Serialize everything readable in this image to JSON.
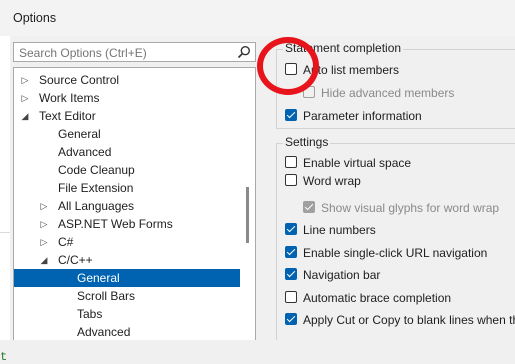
{
  "window": {
    "title": "Options"
  },
  "search": {
    "placeholder": "Search Options (Ctrl+E)",
    "icon": "search-icon"
  },
  "tree": {
    "items": [
      {
        "label": "Source Control",
        "expander": "collapsed"
      },
      {
        "label": "Work Items",
        "expander": "collapsed"
      },
      {
        "label": "Text Editor",
        "expander": "expanded"
      },
      {
        "label": "General",
        "expander": "none"
      },
      {
        "label": "Advanced",
        "expander": "none"
      },
      {
        "label": "Code Cleanup",
        "expander": "none"
      },
      {
        "label": "File Extension",
        "expander": "none"
      },
      {
        "label": "All Languages",
        "expander": "collapsed"
      },
      {
        "label": "ASP.NET Web Forms",
        "expander": "collapsed"
      },
      {
        "label": "C#",
        "expander": "collapsed"
      },
      {
        "label": "C/C++",
        "expander": "expanded"
      },
      {
        "label": "General",
        "expander": "none",
        "selected": true
      },
      {
        "label": "Scroll Bars",
        "expander": "none"
      },
      {
        "label": "Tabs",
        "expander": "none"
      },
      {
        "label": "Advanced",
        "expander": "none"
      }
    ]
  },
  "statement_completion": {
    "legend": "Statement completion",
    "options": [
      {
        "label": "Auto list members",
        "checked": false,
        "enabled": true
      },
      {
        "label": "Hide advanced members",
        "checked": false,
        "enabled": false
      },
      {
        "label": "Parameter information",
        "checked": true,
        "enabled": true
      }
    ]
  },
  "settings": {
    "legend": "Settings",
    "options": [
      {
        "label": "Enable virtual space",
        "checked": false,
        "enabled": true
      },
      {
        "label": "Word wrap",
        "checked": false,
        "enabled": true
      },
      {
        "label": "Show visual glyphs for word wrap",
        "checked": true,
        "enabled": false
      },
      {
        "label": "Line numbers",
        "checked": true,
        "enabled": true
      },
      {
        "label": "Enable single-click URL navigation",
        "checked": true,
        "enabled": true
      },
      {
        "label": "Navigation bar",
        "checked": true,
        "enabled": true
      },
      {
        "label": "Automatic brace completion",
        "checked": false,
        "enabled": true
      },
      {
        "label": "Apply Cut or Copy to blank lines when th",
        "checked": true,
        "enabled": true
      }
    ]
  },
  "background": {
    "editor_fragment": "t"
  },
  "colors": {
    "selection": "#0063b1",
    "annotation": "#e8141b",
    "checkbox_checked": "#0063b1"
  }
}
